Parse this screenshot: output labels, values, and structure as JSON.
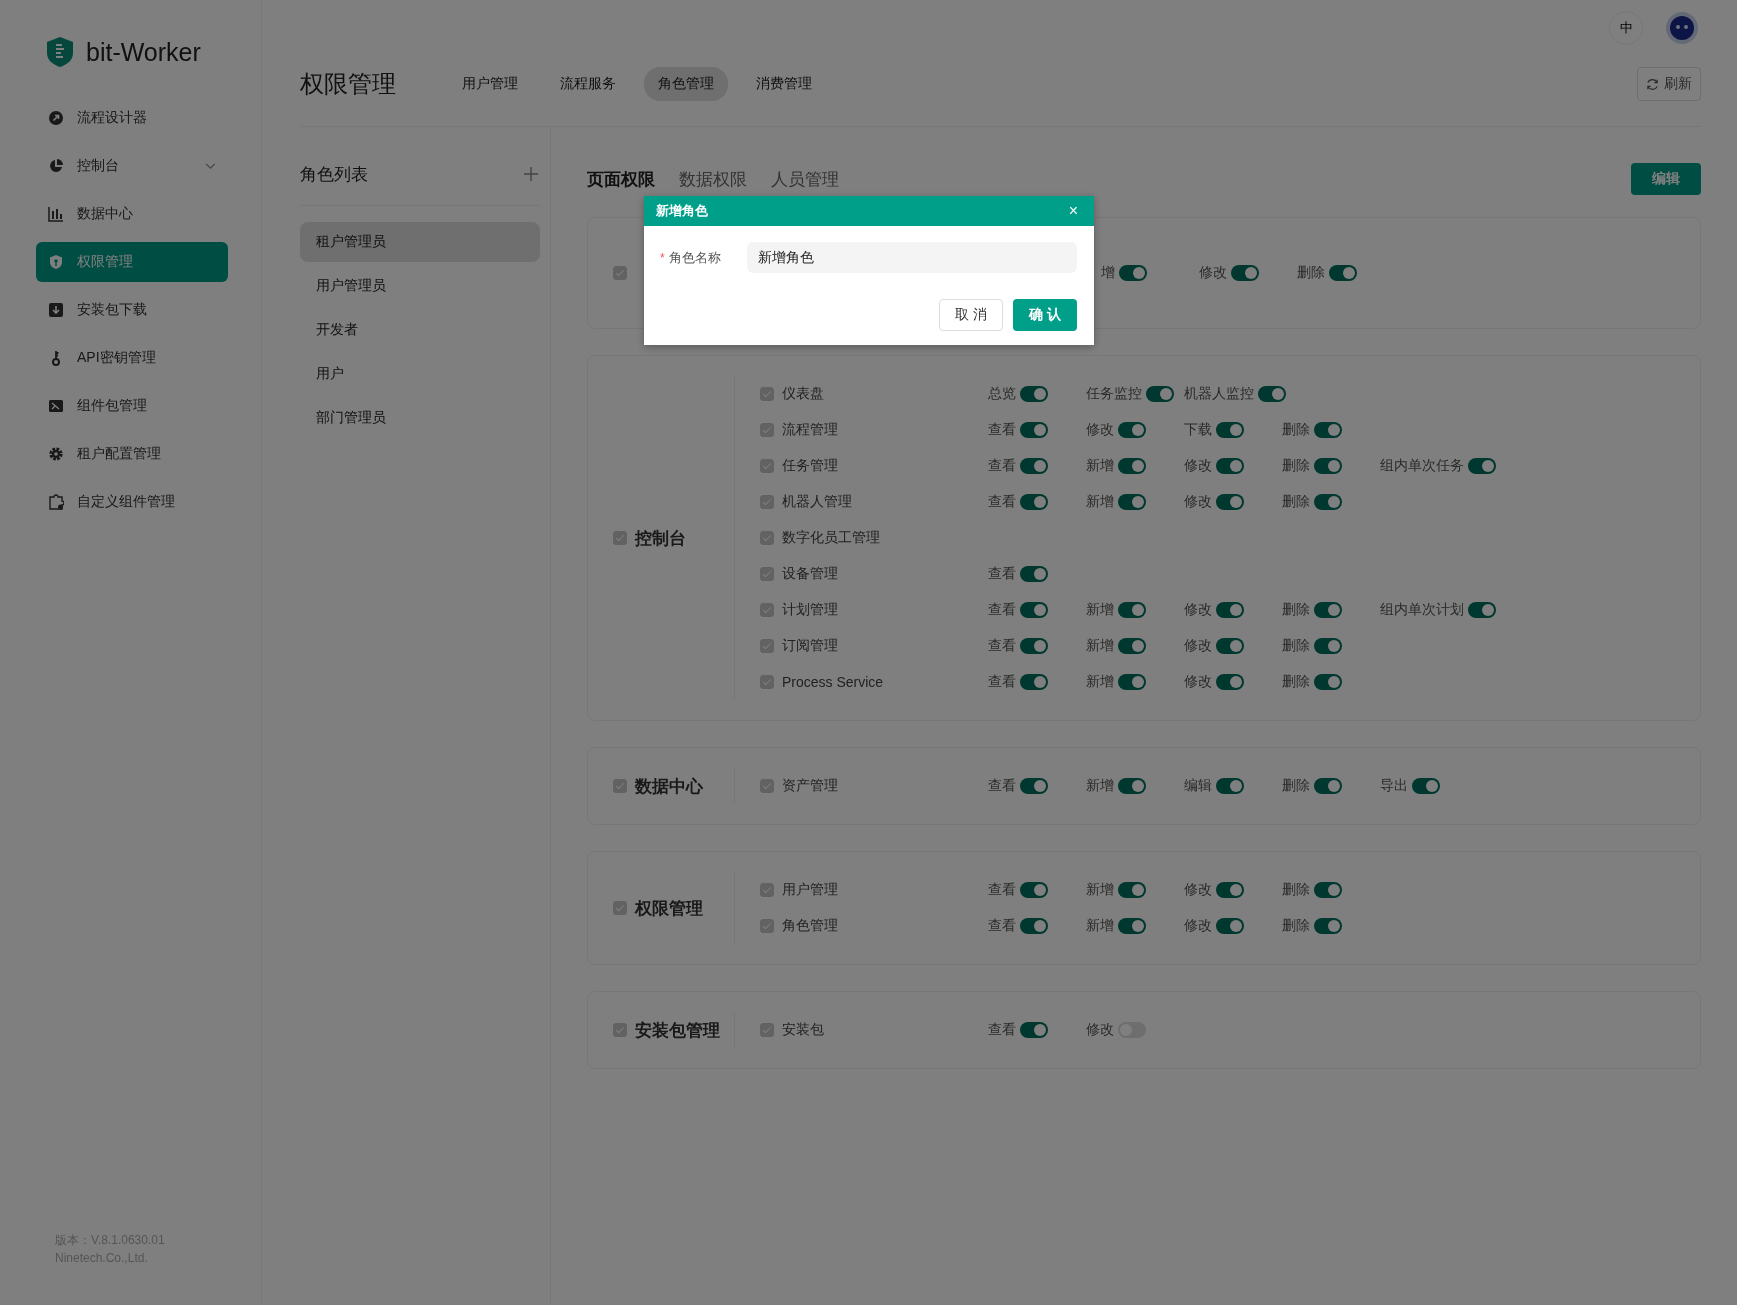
{
  "brand": {
    "name": "bit-Worker"
  },
  "sidebar": {
    "items": [
      {
        "label": "流程设计器",
        "kind": "link",
        "selected": false
      },
      {
        "label": "控制台",
        "kind": "group",
        "selected": false
      },
      {
        "label": "数据中心",
        "kind": "link",
        "selected": false
      },
      {
        "label": "权限管理",
        "kind": "link",
        "selected": true
      },
      {
        "label": "安装包下载",
        "kind": "link",
        "selected": false
      },
      {
        "label": "API密钥管理",
        "kind": "link",
        "selected": false
      },
      {
        "label": "组件包管理",
        "kind": "link",
        "selected": false
      },
      {
        "label": "租户配置管理",
        "kind": "link",
        "selected": false
      },
      {
        "label": "自定义组件管理",
        "kind": "link",
        "selected": false
      }
    ],
    "version": "版本：V.8.1.0630.01",
    "company": "Ninetech.Co.,Ltd."
  },
  "header": {
    "language": "中",
    "title": "权限管理",
    "refresh": "刷新",
    "tabs": [
      {
        "label": "用户管理",
        "selected": false
      },
      {
        "label": "流程服务",
        "selected": false
      },
      {
        "label": "角色管理",
        "selected": true
      },
      {
        "label": "消费管理",
        "selected": false
      }
    ]
  },
  "role_list": {
    "title": "角色列表",
    "roles": [
      {
        "label": "租户管理员",
        "selected": true
      },
      {
        "label": "用户管理员",
        "selected": false
      },
      {
        "label": "开发者",
        "selected": false
      },
      {
        "label": "用户",
        "selected": false
      },
      {
        "label": "部门管理员",
        "selected": false
      }
    ]
  },
  "permissions": {
    "tabs": [
      {
        "label": "页面权限",
        "selected": true
      },
      {
        "label": "数据权限",
        "selected": false
      },
      {
        "label": "人员管理",
        "selected": false
      }
    ],
    "edit": "编辑",
    "groups": [
      {
        "checked": true,
        "rows": [
          {
            "toggles": [
              {
                "label": "增",
                "on": true
              },
              {
                "label": "修改",
                "on": true
              },
              {
                "label": "删除",
                "on": true
              }
            ]
          }
        ]
      },
      {
        "title": "控制台",
        "checked": true,
        "rows": [
          {
            "name": "仪表盘",
            "checked": true,
            "toggles": [
              {
                "label": "总览",
                "on": true
              },
              {
                "label": "任务监控",
                "on": true
              },
              {
                "label": "机器人监控",
                "on": true
              }
            ]
          },
          {
            "name": "流程管理",
            "checked": true,
            "toggles": [
              {
                "label": "查看",
                "on": true
              },
              {
                "label": "修改",
                "on": true
              },
              {
                "label": "下载",
                "on": true
              },
              {
                "label": "删除",
                "on": true
              }
            ]
          },
          {
            "name": "任务管理",
            "checked": true,
            "toggles": [
              {
                "label": "查看",
                "on": true
              },
              {
                "label": "新增",
                "on": true
              },
              {
                "label": "修改",
                "on": true
              },
              {
                "label": "删除",
                "on": true
              },
              {
                "label": "组内单次任务",
                "on": true
              }
            ]
          },
          {
            "name": "机器人管理",
            "checked": true,
            "toggles": [
              {
                "label": "查看",
                "on": true
              },
              {
                "label": "新增",
                "on": true
              },
              {
                "label": "修改",
                "on": true
              },
              {
                "label": "删除",
                "on": true
              }
            ]
          },
          {
            "name": "数字化员工管理",
            "checked": true,
            "toggles": []
          },
          {
            "name": "设备管理",
            "checked": true,
            "toggles": [
              {
                "label": "查看",
                "on": true
              }
            ]
          },
          {
            "name": "计划管理",
            "checked": true,
            "toggles": [
              {
                "label": "查看",
                "on": true
              },
              {
                "label": "新增",
                "on": true
              },
              {
                "label": "修改",
                "on": true
              },
              {
                "label": "删除",
                "on": true
              },
              {
                "label": "组内单次计划",
                "on": true
              }
            ]
          },
          {
            "name": "订阅管理",
            "checked": true,
            "toggles": [
              {
                "label": "查看",
                "on": true
              },
              {
                "label": "新增",
                "on": true
              },
              {
                "label": "修改",
                "on": true
              },
              {
                "label": "删除",
                "on": true
              }
            ]
          },
          {
            "name": "Process Service",
            "checked": true,
            "toggles": [
              {
                "label": "查看",
                "on": true
              },
              {
                "label": "新增",
                "on": true
              },
              {
                "label": "修改",
                "on": true
              },
              {
                "label": "删除",
                "on": true
              }
            ]
          }
        ]
      },
      {
        "title": "数据中心",
        "checked": true,
        "rows": [
          {
            "name": "资产管理",
            "checked": true,
            "toggles": [
              {
                "label": "查看",
                "on": true
              },
              {
                "label": "新增",
                "on": true
              },
              {
                "label": "编辑",
                "on": true
              },
              {
                "label": "删除",
                "on": true
              },
              {
                "label": "导出",
                "on": true
              }
            ]
          }
        ]
      },
      {
        "title": "权限管理",
        "checked": true,
        "rows": [
          {
            "name": "用户管理",
            "checked": true,
            "toggles": [
              {
                "label": "查看",
                "on": true
              },
              {
                "label": "新增",
                "on": true
              },
              {
                "label": "修改",
                "on": true
              },
              {
                "label": "删除",
                "on": true
              }
            ]
          },
          {
            "name": "角色管理",
            "checked": true,
            "toggles": [
              {
                "label": "查看",
                "on": true
              },
              {
                "label": "新增",
                "on": true
              },
              {
                "label": "修改",
                "on": true
              },
              {
                "label": "删除",
                "on": true
              }
            ]
          }
        ]
      },
      {
        "title": "安装包管理",
        "checked": true,
        "rows": [
          {
            "name": "安装包",
            "checked": true,
            "toggles": [
              {
                "label": "查看",
                "on": true
              },
              {
                "label": "修改",
                "on": false
              }
            ]
          }
        ]
      }
    ]
  },
  "dialog": {
    "title": "新增角色",
    "close": "×",
    "field_label": "角色名称",
    "required_mark": "*",
    "field_value": "新增角色",
    "cancel": "取 消",
    "confirm": "确 认"
  }
}
